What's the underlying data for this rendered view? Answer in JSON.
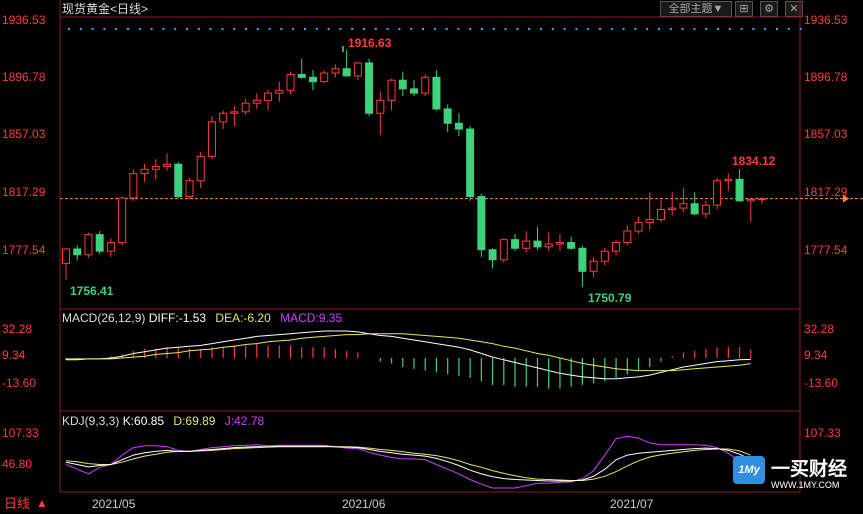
{
  "header": {
    "title": "现货黄金",
    "period": "<日线>",
    "theme_label": "全部主题▼",
    "bottom_period": "日线"
  },
  "main_panel": {
    "yticks": [
      "1936.53",
      "1896.78",
      "1857.03",
      "1817.29",
      "1777.54"
    ],
    "annotations": {
      "high": "1916.63",
      "low1": "1756.41",
      "low2": "1750.79",
      "recent_high": "1834.12"
    },
    "current_price_line": 1813.6
  },
  "macd_panel": {
    "title": "MACD(26,12,9)",
    "diff_label": "DIFF:-1.53",
    "dea_label": "DEA:-6.20",
    "macd_label": "MACD:9.35",
    "yticks": [
      "32.28",
      "9.34",
      "-13.60"
    ]
  },
  "kdj_panel": {
    "title": "KDJ(9,3,3)",
    "k_label": "K:60.85",
    "d_label": "D:69.89",
    "j_label": "J:42.78",
    "yticks": [
      "107.33",
      "46.80"
    ]
  },
  "xaxis": {
    "labels": [
      "2021/05",
      "2021/06",
      "2021/07"
    ]
  },
  "watermark": {
    "brand": "一买财经",
    "site": "WWW.1MY.COM",
    "logo_text": "1My"
  },
  "colors": {
    "up": "#ff3b3b",
    "down": "#3ed27d",
    "diff": "#ffffff",
    "dea": "#e8e85a",
    "j": "#d040ff",
    "grid": "#8a1a1a",
    "price_line": "#ff8a3d"
  },
  "chart_data": {
    "type": "candlestick",
    "y_range": [
      1743,
      1940
    ],
    "candles": [
      [
        1768.5,
        1779.0,
        1757.0,
        1778.5
      ],
      [
        1778.5,
        1781.0,
        1770.5,
        1774.5
      ],
      [
        1774.5,
        1790.0,
        1772.5,
        1788.5
      ],
      [
        1788.5,
        1791.0,
        1775.0,
        1777.0
      ],
      [
        1777.0,
        1786.0,
        1773.0,
        1783.0
      ],
      [
        1783.0,
        1815.0,
        1781.0,
        1814.0
      ],
      [
        1814.0,
        1834.0,
        1812.0,
        1831.0
      ],
      [
        1831.0,
        1838.0,
        1825.0,
        1834.0
      ],
      [
        1834.0,
        1841.0,
        1827.0,
        1836.0
      ],
      [
        1836.0,
        1845.0,
        1833.0,
        1837.5
      ],
      [
        1837.5,
        1839.0,
        1814.0,
        1815.0
      ],
      [
        1815.0,
        1828.0,
        1813.0,
        1826.0
      ],
      [
        1826.0,
        1846.0,
        1821.0,
        1843.0
      ],
      [
        1843.0,
        1871.0,
        1841.0,
        1867.0
      ],
      [
        1867.0,
        1875.0,
        1862.0,
        1873.0
      ],
      [
        1873.0,
        1878.0,
        1864.0,
        1874.0
      ],
      [
        1874.0,
        1883.0,
        1872.0,
        1880.0
      ],
      [
        1880.0,
        1887.0,
        1876.0,
        1882.0
      ],
      [
        1882.0,
        1889.0,
        1875.0,
        1887.0
      ],
      [
        1887.0,
        1895.0,
        1881.0,
        1889.0
      ],
      [
        1889.0,
        1902.0,
        1886.0,
        1900.0
      ],
      [
        1900.0,
        1911.0,
        1897.0,
        1898.0
      ],
      [
        1898.0,
        1903.0,
        1889.0,
        1895.0
      ],
      [
        1895.0,
        1903.0,
        1894.0,
        1901.0
      ],
      [
        1901.0,
        1907.0,
        1898.0,
        1904.0
      ],
      [
        1904.0,
        1917.0,
        1902.0,
        1899.0
      ],
      [
        1899.0,
        1909.0,
        1896.0,
        1908.0
      ],
      [
        1908.0,
        1911.0,
        1871.0,
        1873.0
      ],
      [
        1873.0,
        1888.0,
        1858.0,
        1882.0
      ],
      [
        1882.0,
        1897.0,
        1875.0,
        1896.0
      ],
      [
        1896.0,
        1902.0,
        1885.0,
        1890.0
      ],
      [
        1890.0,
        1896.0,
        1885.0,
        1887.0
      ],
      [
        1887.0,
        1900.0,
        1885.0,
        1898.0
      ],
      [
        1898.0,
        1903.0,
        1875.0,
        1876.0
      ],
      [
        1876.0,
        1879.0,
        1860.0,
        1866.0
      ],
      [
        1866.0,
        1873.0,
        1857.0,
        1862.0
      ],
      [
        1862.0,
        1864.0,
        1812.0,
        1815.0
      ],
      [
        1815.0,
        1817.0,
        1773.0,
        1778.0
      ],
      [
        1778.0,
        1779.0,
        1765.0,
        1771.0
      ],
      [
        1771.0,
        1786.0,
        1769.0,
        1785.0
      ],
      [
        1785.0,
        1789.0,
        1777.0,
        1779.0
      ],
      [
        1779.0,
        1791.0,
        1776.0,
        1784.0
      ],
      [
        1784.0,
        1794.0,
        1778.0,
        1780.0
      ],
      [
        1780.0,
        1790.0,
        1777.0,
        1782.0
      ],
      [
        1782.0,
        1789.0,
        1777.0,
        1783.0
      ],
      [
        1783.0,
        1787.0,
        1778.0,
        1779.0
      ],
      [
        1779.0,
        1781.0,
        1752.0,
        1763.0
      ],
      [
        1763.0,
        1773.0,
        1759.0,
        1770.0
      ],
      [
        1770.0,
        1779.0,
        1767.0,
        1777.0
      ],
      [
        1777.0,
        1785.0,
        1774.0,
        1783.0
      ],
      [
        1783.0,
        1795.0,
        1781.0,
        1791.0
      ],
      [
        1791.0,
        1801.0,
        1789.0,
        1797.0
      ],
      [
        1797.0,
        1818.0,
        1792.0,
        1799.0
      ],
      [
        1799.0,
        1813.0,
        1797.0,
        1806.0
      ],
      [
        1806.0,
        1818.0,
        1802.0,
        1807.0
      ],
      [
        1807.0,
        1821.0,
        1804.0,
        1810.0
      ],
      [
        1810.0,
        1818.0,
        1802.0,
        1803.0
      ],
      [
        1803.0,
        1812.0,
        1800.0,
        1809.0
      ],
      [
        1809.0,
        1828.0,
        1806.0,
        1826.0
      ],
      [
        1826.0,
        1831.0,
        1819.0,
        1827.0
      ],
      [
        1827.0,
        1834.0,
        1812.0,
        1812.0
      ],
      [
        1812.0,
        1814.0,
        1797.0,
        1813.0
      ],
      [
        1813.0,
        1815.0,
        1810.0,
        1813.5
      ]
    ],
    "macd": {
      "diff": [
        -2,
        -2,
        -1,
        -1,
        0,
        2,
        5,
        7,
        9,
        11,
        12,
        13,
        14,
        16,
        18,
        20,
        22,
        24,
        25,
        26,
        27,
        28,
        29,
        30,
        30,
        30,
        29,
        27,
        25,
        24,
        22,
        20,
        18,
        16,
        14,
        12,
        9,
        5,
        1,
        -2,
        -5,
        -8,
        -11,
        -14,
        -17,
        -19,
        -21,
        -22,
        -23,
        -23,
        -22,
        -21,
        -19,
        -16,
        -13,
        -10,
        -8,
        -6,
        -4,
        -3,
        -2,
        -1.53
      ],
      "dea": [
        -1,
        -1,
        -1,
        -1,
        -1,
        0,
        1,
        2,
        4,
        5,
        6,
        8,
        9,
        10,
        12,
        13,
        15,
        16,
        18,
        19,
        20,
        22,
        23,
        24,
        25,
        26,
        26,
        27,
        27,
        27,
        27,
        26,
        25,
        24,
        23,
        22,
        20,
        18,
        16,
        13,
        11,
        8,
        5,
        3,
        0,
        -3,
        -6,
        -8,
        -10,
        -12,
        -13,
        -14,
        -14,
        -14,
        -14,
        -13,
        -12,
        -11,
        -10,
        -9,
        -8,
        -6.2
      ],
      "hist": [
        -2,
        -2,
        0,
        0,
        2,
        4,
        8,
        10,
        10,
        12,
        12,
        10,
        10,
        12,
        12,
        14,
        14,
        16,
        14,
        14,
        14,
        12,
        12,
        12,
        10,
        8,
        6,
        0,
        -4,
        -6,
        -10,
        -12,
        -14,
        -16,
        -18,
        -20,
        -22,
        -26,
        -30,
        -30,
        -32,
        -32,
        -32,
        -34,
        -34,
        -32,
        -30,
        -28,
        -26,
        -22,
        -18,
        -14,
        -10,
        -4,
        2,
        6,
        8,
        10,
        12,
        12,
        12,
        9.35
      ]
    },
    "kdj": {
      "k": [
        55,
        50,
        45,
        48,
        50,
        60,
        70,
        75,
        78,
        80,
        78,
        78,
        80,
        82,
        84,
        86,
        87,
        88,
        88,
        89,
        89,
        89,
        89,
        89,
        88,
        87,
        86,
        82,
        78,
        75,
        72,
        70,
        68,
        63,
        56,
        48,
        38,
        30,
        24,
        20,
        18,
        17,
        16,
        15,
        15,
        15,
        17,
        25,
        40,
        60,
        70,
        74,
        76,
        78,
        80,
        82,
        84,
        85,
        84,
        80,
        72,
        60.85
      ],
      "d": [
        58,
        56,
        52,
        50,
        50,
        55,
        62,
        68,
        72,
        76,
        78,
        78,
        79,
        80,
        82,
        84,
        85,
        86,
        87,
        88,
        88,
        88,
        88,
        88,
        88,
        88,
        87,
        85,
        82,
        80,
        77,
        74,
        72,
        69,
        64,
        58,
        50,
        44,
        37,
        31,
        26,
        22,
        19,
        18,
        17,
        16,
        16,
        19,
        25,
        35,
        47,
        58,
        66,
        71,
        74,
        77,
        80,
        82,
        83,
        83,
        79,
        69.89
      ],
      "j": [
        50,
        40,
        30,
        44,
        50,
        70,
        86,
        90,
        90,
        88,
        80,
        78,
        82,
        86,
        88,
        90,
        91,
        92,
        90,
        91,
        91,
        91,
        91,
        91,
        88,
        85,
        84,
        76,
        70,
        65,
        62,
        62,
        60,
        50,
        40,
        30,
        18,
        8,
        0,
        0,
        0,
        5,
        10,
        10,
        12,
        13,
        20,
        37,
        70,
        105,
        110,
        106,
        96,
        92,
        92,
        92,
        92,
        91,
        86,
        74,
        58,
        42.78
      ]
    }
  }
}
